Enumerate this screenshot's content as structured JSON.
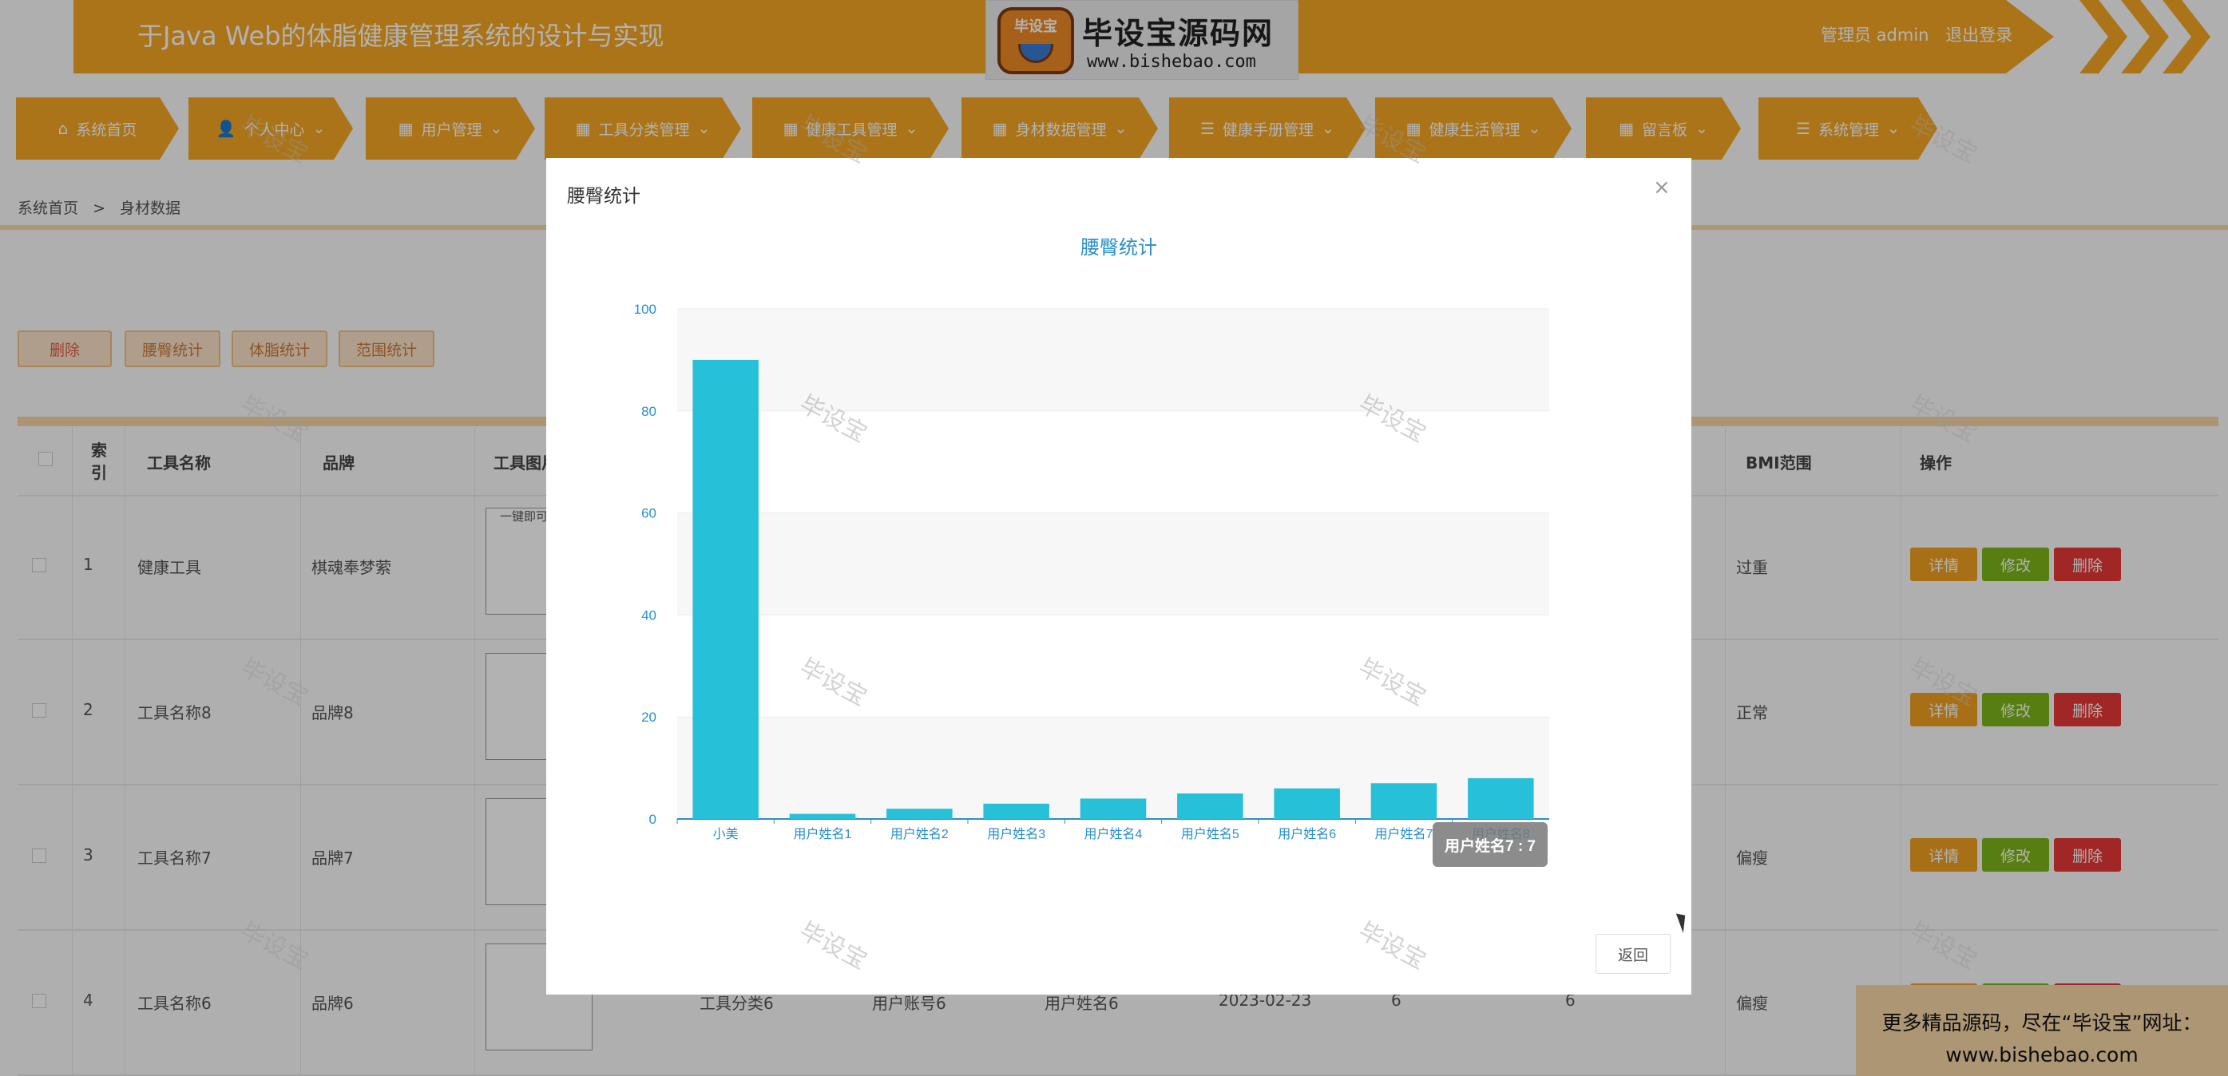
{
  "header": {
    "title": "于Java Web的体脂健康管理系统的设计与实现",
    "admin_label": "管理员 admin",
    "logout": "退出登录"
  },
  "logo": {
    "badge": "毕设宝",
    "name": "毕设宝源码网",
    "url": "www.bishebao.com"
  },
  "nav": {
    "items": [
      {
        "label": "系统首页",
        "icon": "home-icon"
      },
      {
        "label": "个人中心",
        "icon": "user-icon"
      },
      {
        "label": "用户管理",
        "icon": "grid-icon"
      },
      {
        "label": "工具分类管理",
        "icon": "grid-icon"
      },
      {
        "label": "健康工具管理",
        "icon": "grid-icon"
      },
      {
        "label": "身材数据管理",
        "icon": "grid-icon"
      },
      {
        "label": "健康手册管理",
        "icon": "list-icon"
      },
      {
        "label": "健康生活管理",
        "icon": "grid-icon"
      },
      {
        "label": "留言板",
        "icon": "grid-icon"
      },
      {
        "label": "系统管理",
        "icon": "list-icon"
      }
    ]
  },
  "breadcrumb": {
    "home": "系统首页",
    "sep": ">",
    "current": "身材数据"
  },
  "toolbar": {
    "delete": "删除",
    "waist_stats": "腰臀统计",
    "bodyfat_stats": "体脂统计",
    "range_stats": "范围统计"
  },
  "table": {
    "headers": {
      "index": "索\n引",
      "tool_name": "工具名称",
      "brand": "品牌",
      "tool_image": "工具图片",
      "bmi_range": "BMI范围",
      "actions": "操作"
    },
    "rows": [
      {
        "index": "1",
        "tool_name": "健康工具",
        "brand": "棋魂奉梦萦",
        "img_note": "一键即可",
        "bmi": "过重"
      },
      {
        "index": "2",
        "tool_name": "工具名称8",
        "brand": "品牌8",
        "img_note": "",
        "bmi": "正常"
      },
      {
        "index": "3",
        "tool_name": "工具名称7",
        "brand": "品牌7",
        "img_note": "",
        "bmi": "偏瘦"
      },
      {
        "index": "4",
        "tool_name": "工具名称6",
        "brand": "品牌6",
        "img_note": "",
        "bmi": "偏瘦",
        "category": "工具分类6",
        "account": "用户账号6",
        "username": "用户姓名6",
        "date": "2023-02-23",
        "v1": "6",
        "v2": "6"
      }
    ],
    "btn_detail": "详情",
    "btn_edit": "修改",
    "btn_delete": "删除"
  },
  "modal": {
    "title": "腰臀统计",
    "close": "×",
    "back": "返回",
    "tooltip": "用户姓名7 : 7"
  },
  "chart_data": {
    "type": "bar",
    "title": "腰臀统计",
    "categories": [
      "小美",
      "用户姓名1",
      "用户姓名2",
      "用户姓名3",
      "用户姓名4",
      "用户姓名5",
      "用户姓名6",
      "用户姓名7",
      "用户姓名8"
    ],
    "values": [
      90,
      1,
      2,
      3,
      4,
      5,
      6,
      7,
      8
    ],
    "ylim": [
      0,
      100
    ],
    "yticks": [
      0,
      20,
      40,
      60,
      80,
      100
    ],
    "grid": true,
    "bar_color": "#26c0d8"
  },
  "watermark": "毕设宝",
  "ad": {
    "line1": "更多精品源码，尽在“毕设宝”网址：",
    "line2": "www.bishebao.com"
  },
  "colors": {
    "accent": "#f5a623",
    "detail": "#f0a020",
    "edit": "#7cb518",
    "delete": "#e53935"
  }
}
